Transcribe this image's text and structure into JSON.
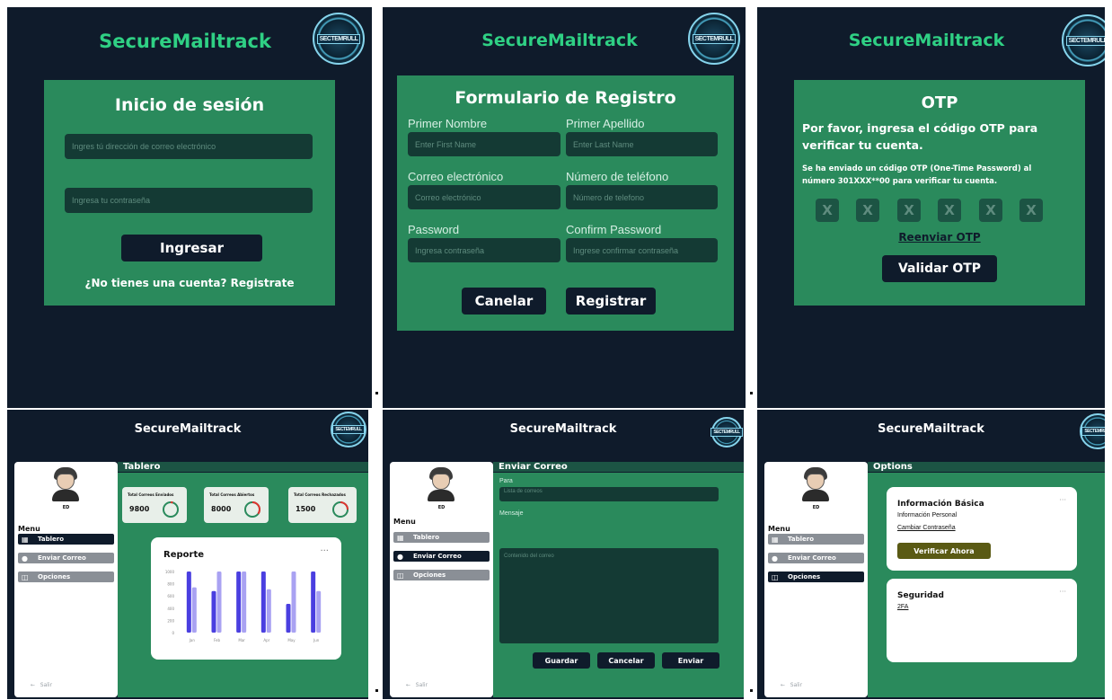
{
  "brand": "SecureMailtrack",
  "seal_text": "SECTEMRULL",
  "login": {
    "title": "Inicio de sesión",
    "email_placeholder": "Ingres tú dirección de correo electrónico",
    "password_placeholder": "Ingresa tu contraseña",
    "submit": "Ingresar",
    "register_link": "¿No tienes una cuenta? Registrate"
  },
  "register": {
    "title": "Formulario de Registro",
    "first_name_label": "Primer Nombre",
    "first_name_placeholder": "Enter First Name",
    "last_name_label": "Primer Apellido",
    "last_name_placeholder": "Enter Last Name",
    "email_label": "Correo electrónico",
    "email_placeholder": "Correo electrónico",
    "phone_label": "Número de teléfono",
    "phone_placeholder": "Número de telefono",
    "password_label": "Password",
    "password_placeholder": "Ingresa contraseña",
    "confirm_label": "Confirm Password",
    "confirm_placeholder": "Ingrese confirmar contraseña",
    "cancel": "Canelar",
    "submit": "Registrar"
  },
  "otp": {
    "title": "OTP",
    "instruction": "Por favor, ingresa el código OTP para verificar tu cuenta.",
    "info": "Se ha enviado un código OTP (One-Time Password) al número 301XXX**00 para verificar tu cuenta.",
    "boxes": [
      "X",
      "X",
      "X",
      "X",
      "X",
      "X"
    ],
    "resend": "Reenviar OTP",
    "validate": "Validar OTP"
  },
  "sidebar": {
    "user": "ED",
    "menu_title": "Menu",
    "items": [
      {
        "label": "Tablero",
        "icon": "grid-icon"
      },
      {
        "label": "Enviar Correo",
        "icon": "mic-icon"
      },
      {
        "label": "Opciones",
        "icon": "settings-icon"
      }
    ],
    "logout": "Salir"
  },
  "dashboard": {
    "title": "Tablero",
    "stats": [
      {
        "label": "Total Correos Enviados",
        "value": "9800",
        "fraction": 0.05
      },
      {
        "label": "Total Correos Abiertos",
        "value": "8000",
        "fraction": 0.35
      },
      {
        "label": "Total Correos Rechazados",
        "value": "1500",
        "fraction": 0.25
      }
    ],
    "report_title": "Reporte",
    "more": "···",
    "chart_data": {
      "type": "bar",
      "title": "Reporte",
      "categories": [
        "Jan",
        "Feb",
        "Mar",
        "Apr",
        "May",
        "Jun"
      ],
      "y_ticks": [
        "1000",
        "800",
        "600",
        "400",
        "200",
        "0"
      ],
      "ylim": [
        0,
        1000
      ],
      "series": [
        {
          "values": [
            1000,
            680,
            1000,
            1000,
            470,
            1000
          ],
          "color": "#4a3fe0"
        },
        {
          "values": [
            740,
            1000,
            1000,
            710,
            1000,
            680
          ],
          "color": "#a9a2f2"
        }
      ]
    }
  },
  "send_mail": {
    "title": "Enviar Correo",
    "to_label": "Para",
    "to_placeholder": "Lista de correos",
    "message_label": "Mensaje",
    "message_placeholder": "Contenido del correo",
    "save": "Guardar",
    "cancel": "Cancelar",
    "send": "Enviar"
  },
  "options": {
    "title": "Options",
    "basic_title": "Información Básica",
    "basic_personal": "Información Personal",
    "basic_change_password": "Cambiar Contraseña",
    "verify_button": "Verificar Ahora",
    "security_title": "Seguridad",
    "security_2fa": "2FA",
    "more": "···"
  },
  "colors": {
    "bg": "#0f1b2b",
    "card": "#2a8a5c",
    "accent": "#2fd084",
    "input": "#143a34",
    "olive": "#5a5a14"
  }
}
